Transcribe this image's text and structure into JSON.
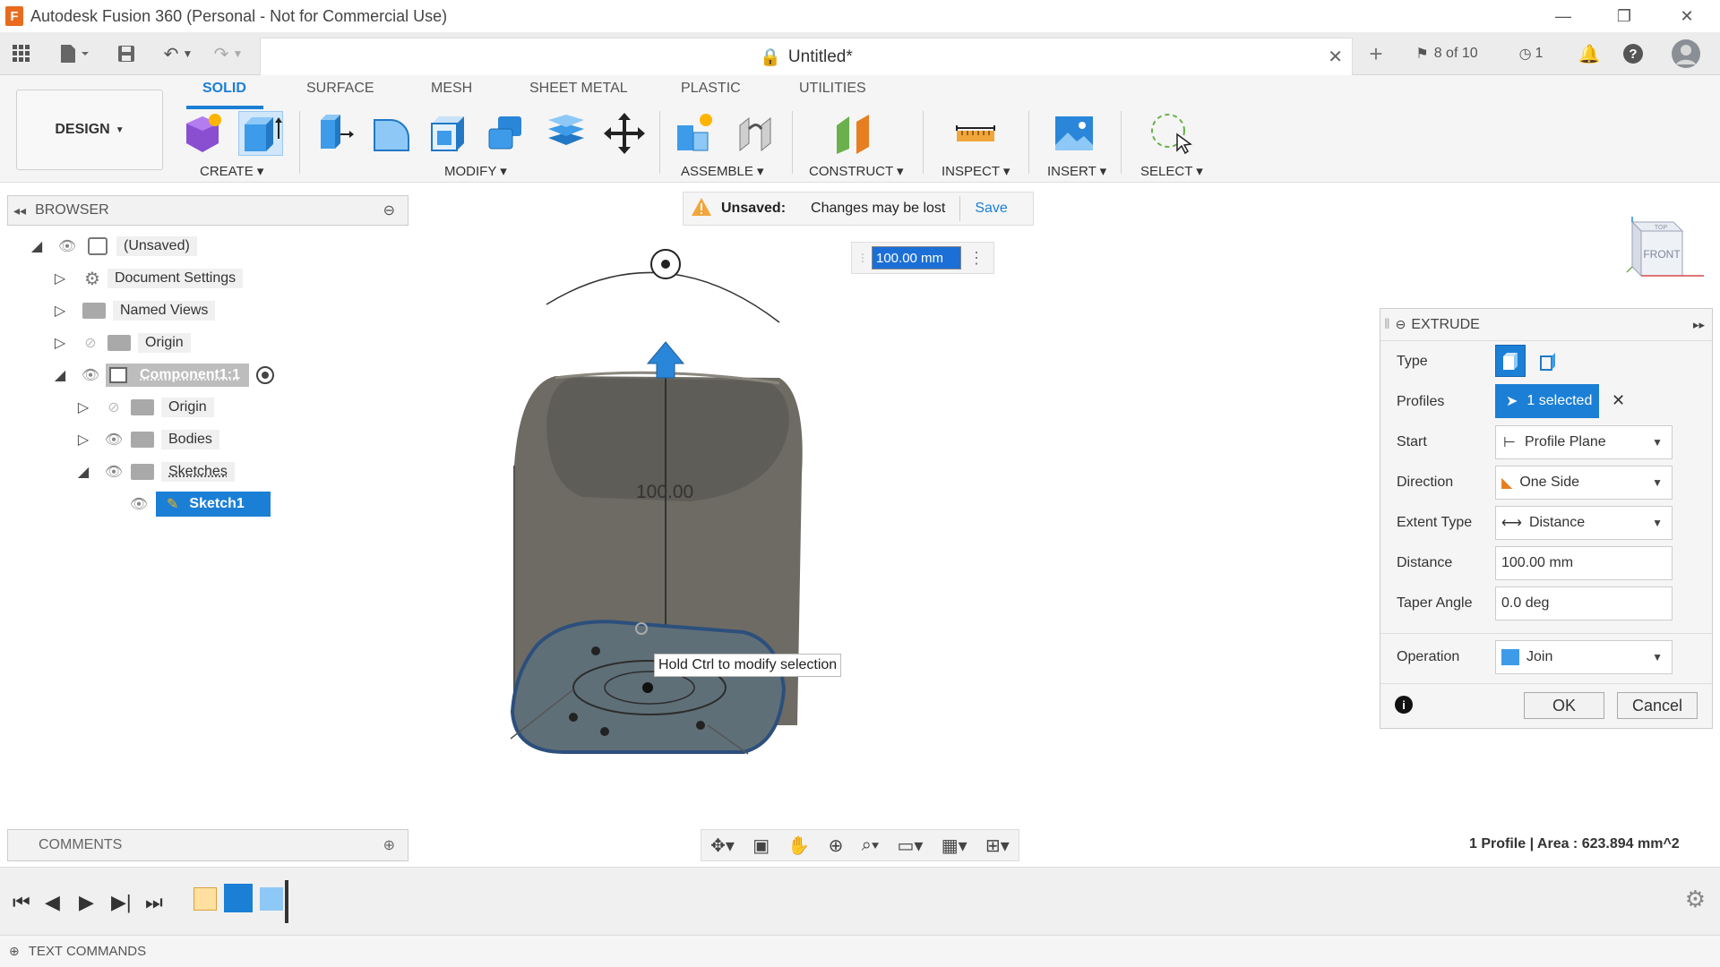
{
  "window": {
    "title": "Autodesk Fusion 360 (Personal - Not for Commercial Use)",
    "logo_letter": "F"
  },
  "tab": {
    "title": "Untitled*"
  },
  "header_right": {
    "jobs": "8 of 10",
    "clock_count": "1"
  },
  "workspace": {
    "label": "DESIGN"
  },
  "toolbar": {
    "tabs": [
      "SOLID",
      "SURFACE",
      "MESH",
      "SHEET METAL",
      "PLASTIC",
      "UTILITIES"
    ],
    "groups": [
      "CREATE",
      "MODIFY",
      "ASSEMBLE",
      "CONSTRUCT",
      "INSPECT",
      "INSERT",
      "SELECT"
    ]
  },
  "browser": {
    "title": "BROWSER",
    "root": "(Unsaved)",
    "items": [
      "Document Settings",
      "Named Views",
      "Origin"
    ],
    "component": "Component1:1",
    "children": [
      "Origin",
      "Bodies",
      "Sketches"
    ],
    "sketch": "Sketch1"
  },
  "unsaved": {
    "label": "Unsaved:",
    "message": "Changes may be lost",
    "save": "Save"
  },
  "canvas": {
    "distance_input": "100.00 mm",
    "dimension_label": "100.00",
    "tooltip": "Hold Ctrl to modify selection"
  },
  "viewcube": {
    "top": "TOP",
    "front": "FRONT"
  },
  "extrude": {
    "title": "EXTRUDE",
    "labels": {
      "type": "Type",
      "profiles": "Profiles",
      "start": "Start",
      "direction": "Direction",
      "extent": "Extent Type",
      "distance": "Distance",
      "taper": "Taper Angle",
      "operation": "Operation"
    },
    "profiles_value": "1 selected",
    "start_value": "Profile Plane",
    "direction_value": "One Side",
    "extent_value": "Distance",
    "distance_value": "100.00 mm",
    "taper_value": "0.0 deg",
    "operation_value": "Join",
    "ok": "OK",
    "cancel": "Cancel"
  },
  "comments": {
    "title": "COMMENTS"
  },
  "status": {
    "text": "1 Profile | Area : 623.894 mm^2"
  },
  "text_commands": {
    "title": "TEXT COMMANDS"
  },
  "colors": {
    "accent": "#1b7fd6",
    "body": "#6d6b64"
  }
}
